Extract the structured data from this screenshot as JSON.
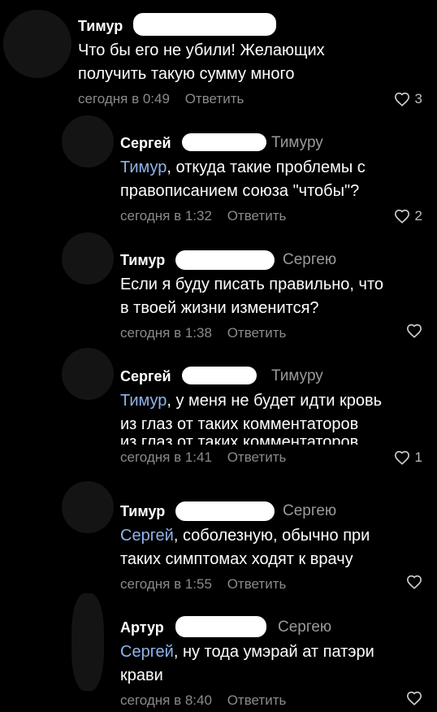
{
  "comments": [
    {
      "author": "Тимур",
      "reply_to": "",
      "mention": "",
      "text": [
        "Что бы его не убили! Желающих",
        "получить такую сумму много"
      ],
      "time": "сегодня в 0:49",
      "reply_label": "Ответить",
      "likes": "3"
    },
    {
      "author": "Сергей",
      "reply_to": "Тимуру",
      "mention": "Тимур",
      "text": [
        ", откуда такие проблемы с",
        "правописанием союза \"чтобы\"?"
      ],
      "time": "сегодня в 1:32",
      "reply_label": "Ответить",
      "likes": "2"
    },
    {
      "author": "Тимур",
      "reply_to": "Сергею",
      "mention": "",
      "text": [
        "Если я буду писать правильно, что",
        "в твоей жизни изменится?"
      ],
      "time": "сегодня в 1:38",
      "reply_label": "Ответить",
      "likes": ""
    },
    {
      "author": "Сергей",
      "reply_to": "Тимуру",
      "mention": "Тимур",
      "text": [
        ", у меня не будет идти кровь",
        "из глаз от таких комментаторов"
      ],
      "ghost_text": "из глаз от таких комментаторов",
      "time": "сегодня в 1:41",
      "reply_label": "Ответить",
      "likes": "1"
    },
    {
      "author": "Тимур",
      "reply_to": "Сергею",
      "mention": "Сергей",
      "text": [
        ", соболезную, обычно при",
        "таких симптомах ходят к врачу"
      ],
      "time": "сегодня в 1:55",
      "reply_label": "Ответить",
      "likes": ""
    },
    {
      "author": "Артур",
      "reply_to": "Сергею",
      "mention": "Сергей",
      "text": [
        ", ну тода умэрай ат патэри",
        "крави"
      ],
      "time": "сегодня в 8:40",
      "reply_label": "Ответить",
      "likes": ""
    }
  ]
}
